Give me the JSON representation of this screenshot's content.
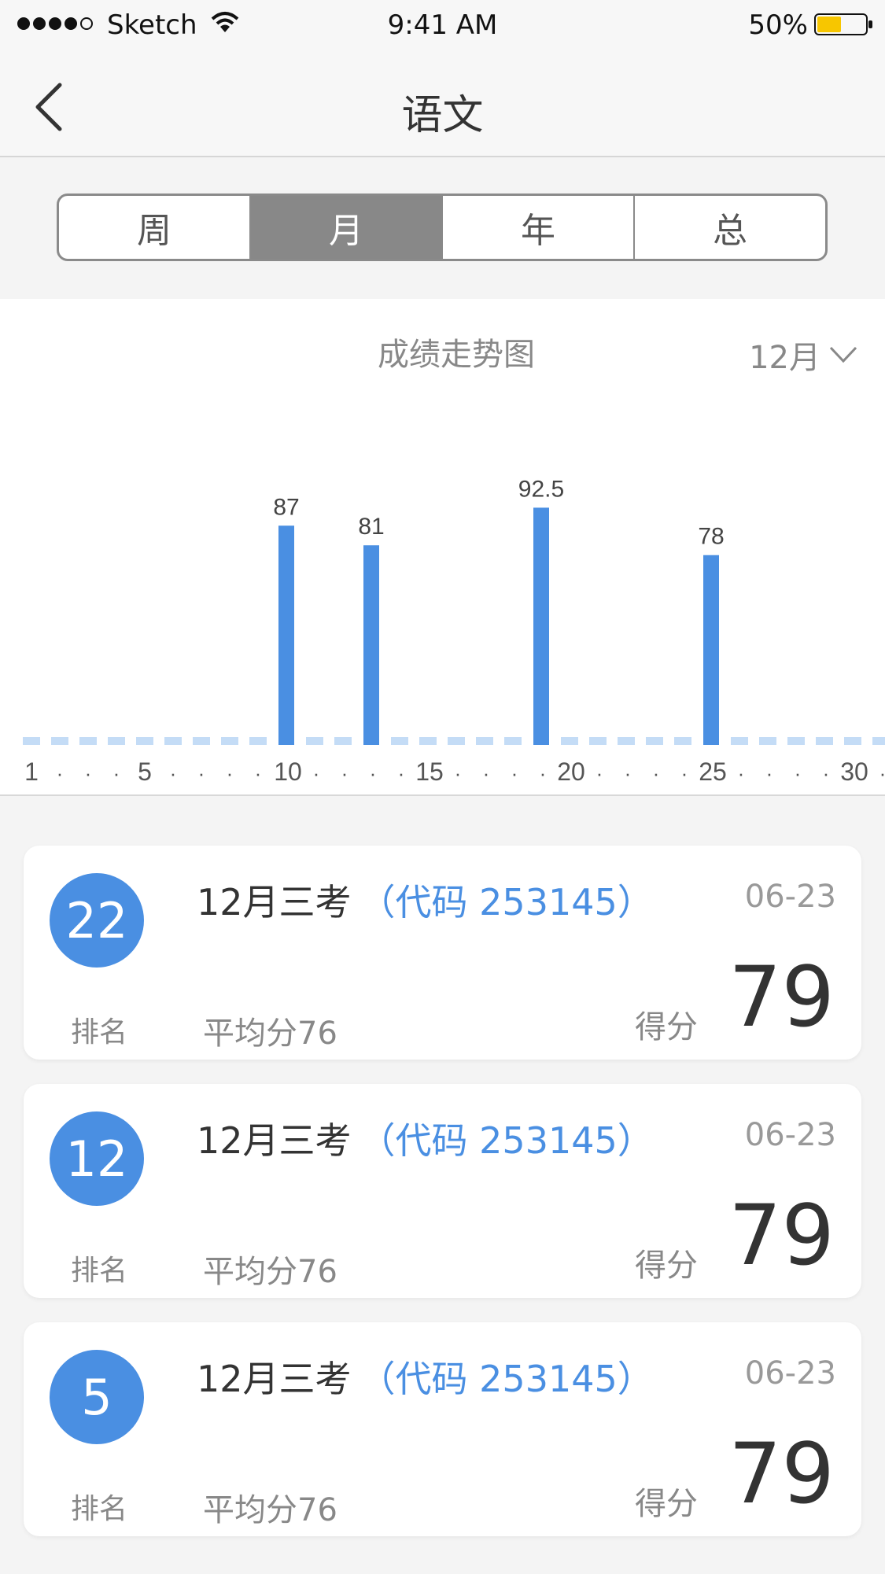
{
  "status": {
    "carrier": "Sketch",
    "time": "9:41 AM",
    "battery_pct": "50%"
  },
  "nav": {
    "title": "语文",
    "back_icon": "chevron-left-icon"
  },
  "segments": [
    {
      "label": "周",
      "active": false
    },
    {
      "label": "月",
      "active": true
    },
    {
      "label": "年",
      "active": false
    },
    {
      "label": "总",
      "active": false
    }
  ],
  "chart_header": {
    "title": "成绩走势图",
    "month": "12月"
  },
  "chart_data": {
    "type": "bar",
    "x_range": [
      1,
      31
    ],
    "tick_labels": [
      "1",
      "5",
      "10",
      "15",
      "20",
      "25",
      "30"
    ],
    "x": [
      10,
      13,
      19,
      25
    ],
    "values": [
      87,
      81,
      92.5,
      78
    ],
    "value_labels": [
      "87",
      "81",
      "92.5",
      "78"
    ],
    "colors": {
      "bar": "#4a8fe2",
      "baseline": "#c4dcf6"
    }
  },
  "records": [
    {
      "rank": "22",
      "rank_label": "排名",
      "name": "12月三考",
      "code": "（代码 253145）",
      "date": "06-23",
      "avg": "平均分76",
      "score_label": "得分",
      "score": "79"
    },
    {
      "rank": "12",
      "rank_label": "排名",
      "name": "12月三考",
      "code": "（代码 253145）",
      "date": "06-23",
      "avg": "平均分76",
      "score_label": "得分",
      "score": "79"
    },
    {
      "rank": "5",
      "rank_label": "排名",
      "name": "12月三考",
      "code": "（代码 253145）",
      "date": "06-23",
      "avg": "平均分76",
      "score_label": "得分",
      "score": "79"
    }
  ],
  "colors": {
    "accent": "#4a8fe2",
    "segment_active": "#888888"
  }
}
